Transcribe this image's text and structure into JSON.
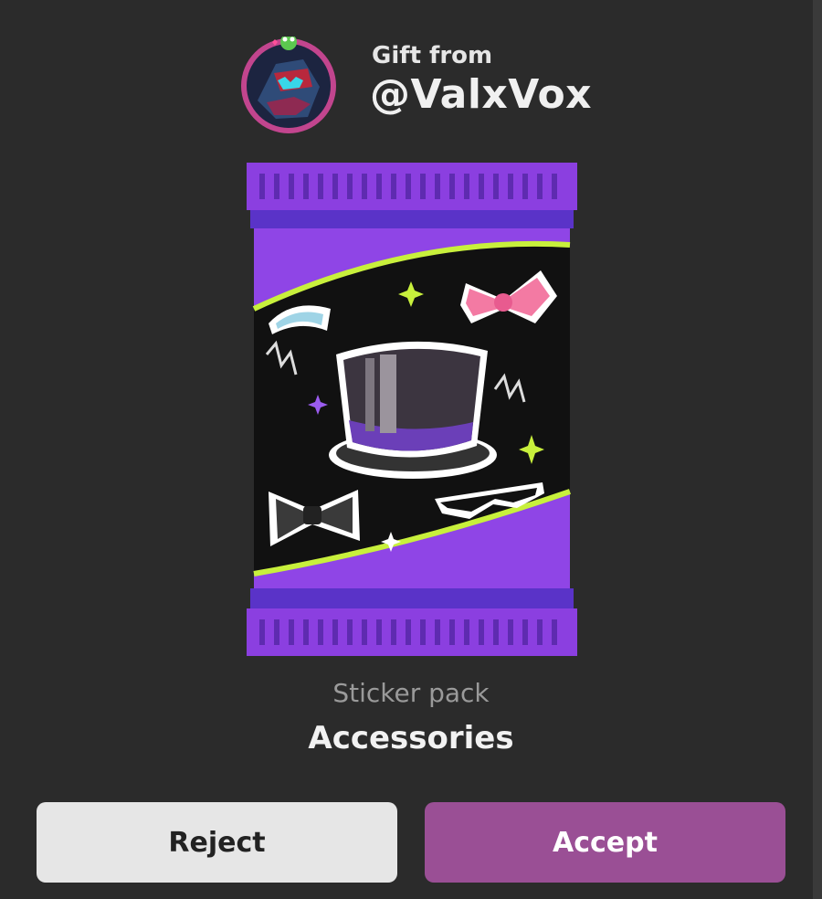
{
  "header": {
    "gift_from_label": "Gift from",
    "sender": "@ValxVox"
  },
  "item": {
    "type_label": "Sticker pack",
    "name": "Accessories"
  },
  "actions": {
    "reject_label": "Reject",
    "accept_label": "Accept"
  },
  "colors": {
    "background": "#2b2b2b",
    "accept": "#9a4f95",
    "reject": "#e6e6e6",
    "pack_purple": "#8b3fe0",
    "pack_accent": "#c8f03c"
  },
  "icons": [
    "sender-avatar",
    "sticker-pack-image",
    "top-hat-sticker",
    "bow-sticker",
    "bow-tie-sticker",
    "tiara-sticker",
    "sunglasses-sticker"
  ]
}
